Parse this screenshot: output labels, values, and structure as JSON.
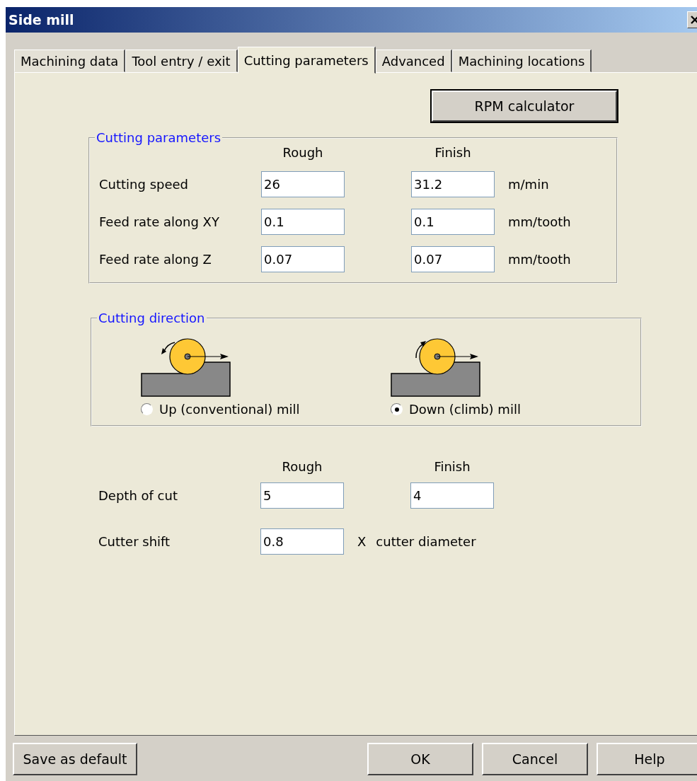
{
  "window": {
    "title": "Side mill"
  },
  "tabs": [
    {
      "label": "Machining data",
      "selected": false
    },
    {
      "label": "Tool entry / exit",
      "selected": false
    },
    {
      "label": "Cutting parameters",
      "selected": true
    },
    {
      "label": "Advanced",
      "selected": false
    },
    {
      "label": "Machining locations",
      "selected": false
    }
  ],
  "rpm_button": "RPM calculator",
  "cutting_parameters": {
    "title": "Cutting parameters",
    "columns": [
      "Rough",
      "Finish"
    ],
    "rows": [
      {
        "label": "Cutting speed",
        "rough": "26",
        "finish": "31.2",
        "unit": "m/min"
      },
      {
        "label": "Feed rate along  XY",
        "rough": "0.1",
        "finish": "0.1",
        "unit": "mm/tooth"
      },
      {
        "label": "Feed rate along  Z",
        "rough": "0.07",
        "finish": "0.07",
        "unit": "mm/tooth"
      }
    ]
  },
  "cutting_direction": {
    "title": "Cutting direction",
    "options": [
      {
        "kind": "up",
        "label": "Up (conventional) mill",
        "selected": false
      },
      {
        "kind": "down",
        "label": "Down (climb) mill",
        "selected": true
      }
    ]
  },
  "depth": {
    "columns": [
      "Rough",
      "Finish"
    ],
    "rows": [
      {
        "label": "Depth of cut",
        "rough": "5",
        "finish": "4"
      }
    ]
  },
  "cutter_shift": {
    "label": "Cutter shift",
    "value": "0.8",
    "multiplier": "X",
    "suffix": "cutter diameter"
  },
  "buttons": {
    "left": [
      "Save as default"
    ],
    "right": [
      "OK",
      "Cancel",
      "Help"
    ]
  }
}
